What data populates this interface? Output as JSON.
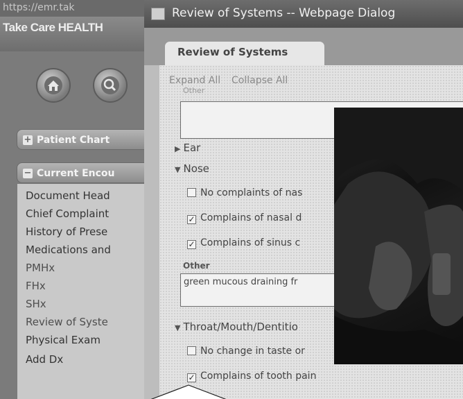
{
  "browser": {
    "url": "https://emr.tak"
  },
  "app": {
    "brand": "Take Care HEALTH"
  },
  "nav": {
    "patient_chart": "Patient Chart",
    "current_encounter": "Current Encou",
    "items": [
      "Document Head",
      "Chief Complaint",
      "History of Prese",
      "Medications and",
      "PMHx",
      "FHx",
      "SHx",
      "Review of Syste",
      "Physical Exam",
      "Add Dx"
    ]
  },
  "dialog": {
    "title": "Review of Systems -- Webpage Dialog",
    "tab": "Review of Systems",
    "expand_all": "Expand All",
    "collapse_all": "Collapse All",
    "cut_label": "Other",
    "sections": {
      "ear": "Ear",
      "nose": "Nose",
      "throat": "Throat/Mouth/Dentitio"
    },
    "nose_items": [
      "No complaints of nas",
      "Complains of nasal d",
      "Complains of sinus c"
    ],
    "nose_checked": [
      false,
      true,
      true
    ],
    "other_label": "Other",
    "other_nose_value": "green mucous draining fr",
    "throat_items": [
      "No change in taste or",
      "Complains of tooth pain"
    ],
    "throat_checked": [
      false,
      true
    ]
  },
  "icons": {
    "home": "home-icon",
    "search": "search-icon",
    "dialog": "dialog-window-icon"
  }
}
